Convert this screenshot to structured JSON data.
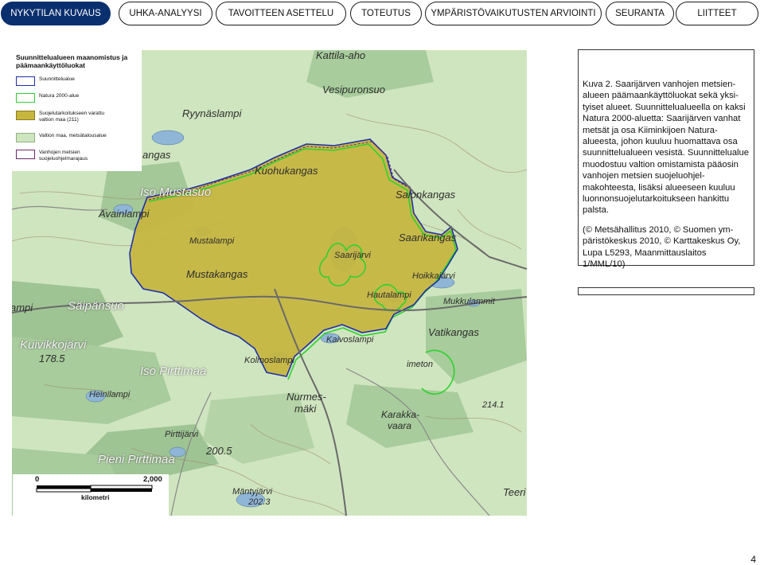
{
  "nav": {
    "tabs": [
      {
        "label": "NYKYTILAN KUVAUS",
        "active": true
      },
      {
        "label": "UHKA-ANALYYSI",
        "active": false
      },
      {
        "label": "TAVOITTEEN ASETTELU",
        "active": false
      },
      {
        "label": "TOTEUTUS",
        "active": false
      },
      {
        "label": "YMPÄRISTÖVAIKUTUSTEN ARVIOINTI",
        "active": false
      },
      {
        "label": "SEURANTA",
        "active": false
      },
      {
        "label": "LIITTEET",
        "active": false
      }
    ]
  },
  "legend": {
    "title": "Suunnittelualueen maanomistus ja päämaankäyttöluokat",
    "items": [
      {
        "label": "Suunnittelualue",
        "swatch": "outline",
        "color": "#1f2fa8"
      },
      {
        "label": "Natura 2000-alue",
        "swatch": "outline",
        "color": "#2fd12f"
      },
      {
        "label": "Suojelutarkoitukseen varattu valtion maa (211)",
        "swatch": "fill",
        "color": "#c6b63e"
      },
      {
        "label": "Valtion maa, metsätalousalue",
        "swatch": "fill",
        "color": "#cfe5bf"
      },
      {
        "label": "Vanhojen metsien suojeluohjelmarajaus",
        "swatch": "outline",
        "color": "#6a2a6e"
      }
    ]
  },
  "map_labels": [
    {
      "text": "Kattila-aho",
      "big": false
    },
    {
      "text": "Vesipuronsuo",
      "big": false
    },
    {
      "text": "Ryynäslampi",
      "big": false
    },
    {
      "text": "angas",
      "big": false
    },
    {
      "text": "Kuohukangas",
      "big": false
    },
    {
      "text": "Iso Mustasuo",
      "big": true
    },
    {
      "text": "Salonkangas",
      "big": false
    },
    {
      "text": "Avainlampi",
      "big": false
    },
    {
      "text": "Saarikangas",
      "big": false
    },
    {
      "text": "Mustalampi",
      "big": false
    },
    {
      "text": "Saarijärvi",
      "big": false
    },
    {
      "text": "Mustakangas",
      "big": false
    },
    {
      "text": "Hoikkajärvi",
      "big": false
    },
    {
      "text": "Hautalampi",
      "big": false
    },
    {
      "text": "Säipänsuo",
      "big": true
    },
    {
      "text": "ampi",
      "big": false
    },
    {
      "text": "Mukkulammit",
      "big": false
    },
    {
      "text": "Vatikangas",
      "big": false
    },
    {
      "text": "Kaivoslampi",
      "big": false
    },
    {
      "text": "Kuivikkojärvi",
      "big": true
    },
    {
      "text": "178.5",
      "big": false
    },
    {
      "text": "Kolmoslampi",
      "big": false
    },
    {
      "text": "Iso Pirttimaa",
      "big": true
    },
    {
      "text": "Heinilampi",
      "big": false
    },
    {
      "text": "Nurmes-",
      "big": false
    },
    {
      "text": "mäki",
      "big": false
    },
    {
      "text": "214.1",
      "big": false
    },
    {
      "text": "Karakka-",
      "big": false
    },
    {
      "text": "vaara",
      "big": false
    },
    {
      "text": "Pirttijärvi",
      "big": false
    },
    {
      "text": "200.5",
      "big": false
    },
    {
      "text": "Pieni Pirttimaa",
      "big": true
    },
    {
      "text": "Mäntyjärvi",
      "big": false
    },
    {
      "text": "202.3",
      "big": false
    },
    {
      "text": "Teeri",
      "big": false
    },
    {
      "text": "imeton",
      "big": false
    }
  ],
  "scale": {
    "start": "0",
    "end": "2,000",
    "unit": "kilometri"
  },
  "caption": {
    "text": "Kuva 2. Saarijärven vanhojen metsien­alueen päämaankäyttöluokat sekä yksi­tyiset alueet. Suunnittelualueella on kaksi Natura 2000-aluetta: Saarijärven vanhat metsät ja osa Kiiminkijoen Natu­ra-alueesta, johon kuuluu huomattava osa suunnittelualueen vesistä. Suunnit­telualue muodostuu valtion omistamista pääosin vanhojen metsien suojeluohjel­makohteesta, lisäksi alueeseen kuuluu luonnonsuojelutarkoitukseen hankittu palsta.",
    "credit": "(© Metsähallitus 2010, © Suomen ym­päristökeskus 2010, © Karttakeskus Oy, Lupa L5293, Maanmittauslaitos 1/MML/10)"
  },
  "page_number": "4"
}
